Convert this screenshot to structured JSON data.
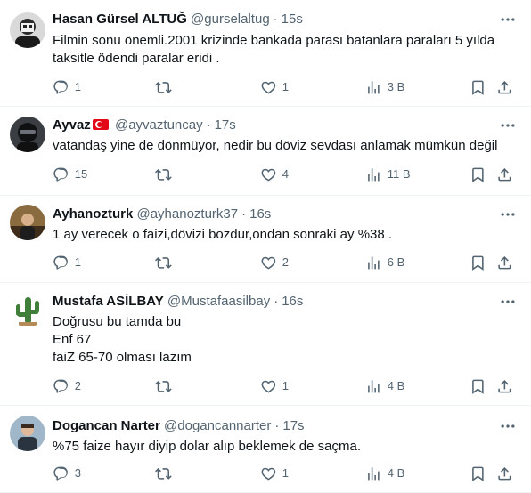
{
  "tweets": [
    {
      "name": "Hasan Gürsel ALTUĞ",
      "handle": "@gurselaltug",
      "time": "15s",
      "text_lines": [
        "Filmin sonu önemli.2001 krizinde bankada parası batanlara paraları 5 yılda",
        "taksitle ödendi paralar eridi ."
      ],
      "replies": "1",
      "retweets": "",
      "likes": "1",
      "views": "3 B"
    },
    {
      "name": "Ayvaz",
      "has_flag": true,
      "flag_icon": "turkey-flag-icon",
      "handle": "@ayvaztuncay",
      "time": "17s",
      "text_lines": [
        "vatandaş yine de dönmüyor, nedir bu döviz sevdası anlamak mümkün değil"
      ],
      "replies": "15",
      "retweets": "",
      "likes": "4",
      "views": "11 B"
    },
    {
      "name": "Ayhanozturk",
      "handle": "@ayhanozturk37",
      "time": "16s",
      "text_lines": [
        "1 ay verecek o faizi,dövizi bozdur,ondan sonraki ay %38 ."
      ],
      "replies": "1",
      "retweets": "",
      "likes": "2",
      "views": "6 B"
    },
    {
      "name": "Mustafa ASİLBAY",
      "handle": "@Mustafaasilbay",
      "time": "16s",
      "text_lines": [
        "Doğrusu bu tamda bu",
        "Enf 67",
        "faiZ 65-70 olması lazım"
      ],
      "replies": "2",
      "retweets": "",
      "likes": "1",
      "views": "4 B"
    },
    {
      "name": "Dogancan Narter",
      "handle": "@dogancannarter",
      "time": "17s",
      "text_lines": [
        "%75 faize hayır diyip dolar alıp beklemek de saçma."
      ],
      "replies": "3",
      "retweets": "",
      "likes": "1",
      "views": "4 B"
    }
  ],
  "dot": "·",
  "icons": {
    "more": "more-horizontal-icon",
    "reply": "reply-icon",
    "retweet": "retweet-icon",
    "like": "heart-icon",
    "views": "views-chart-icon",
    "bookmark": "bookmark-icon",
    "share": "share-icon"
  },
  "colors": {
    "text": "#0f1419",
    "muted": "#536471",
    "border": "#eff3f4",
    "flag_red": "#e30a17"
  }
}
